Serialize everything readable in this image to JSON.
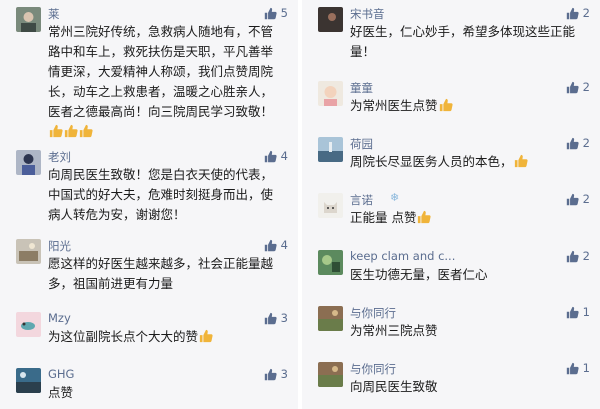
{
  "left": [
    {
      "name": "莱",
      "likes": "5",
      "text": "常州三院好传统，急救病人随地有，不管路中和车上，救死扶伤是天职，平凡善举情更深，大爱精神人称颂，我们点赞周院长，动车之上救患者，温暖之心胜亲人，医者之德最高尚！向三院周民学习致敬！",
      "avatar": "avatar-portrait-icon"
    },
    {
      "name": "老刘",
      "likes": "4",
      "text": "向周民医生致敬！您是白衣天使的代表，中国式的好大夫，危难时刻挺身而出，使病人转危为安，谢谢您！",
      "avatar": "avatar-person-icon"
    },
    {
      "name": "阳光",
      "likes": "4",
      "text": "愿这样的好医生越来越多，社会正能量越多，祖国前进更有力量",
      "avatar": "avatar-photo-icon"
    },
    {
      "name": "Mzy",
      "likes": "3",
      "text": "为这位副院长点个大大的赞",
      "avatar": "avatar-bird-icon"
    },
    {
      "name": "GHG",
      "likes": "3",
      "text": "点赞",
      "avatar": "avatar-landscape-icon"
    }
  ],
  "right": [
    {
      "name": "宋书音",
      "likes": "2",
      "text": "好医生，仁心妙手，希望多体现这些正能量！",
      "avatar": "avatar-dark-photo-icon"
    },
    {
      "name": "童童",
      "likes": "2",
      "text": "为常州医生点赞",
      "avatar": "avatar-child-icon"
    },
    {
      "name": "荷园",
      "likes": "2",
      "text": "周院长尽显医务人员的本色，",
      "avatar": "avatar-sea-icon"
    },
    {
      "name": "言诺",
      "likes": "2",
      "text": "正能量 点赞",
      "avatar": "avatar-cat-icon"
    },
    {
      "name": "keep clam and c...",
      "likes": "2",
      "text": "医生功德无量，医者仁心",
      "avatar": "avatar-green-photo-icon"
    },
    {
      "name": "与你同行",
      "likes": "1",
      "text": "为常州三院点赞",
      "avatar": "avatar-field-icon"
    },
    {
      "name": "与你同行",
      "likes": "1",
      "text": "向周民医生致敬",
      "avatar": "avatar-field-icon"
    }
  ]
}
